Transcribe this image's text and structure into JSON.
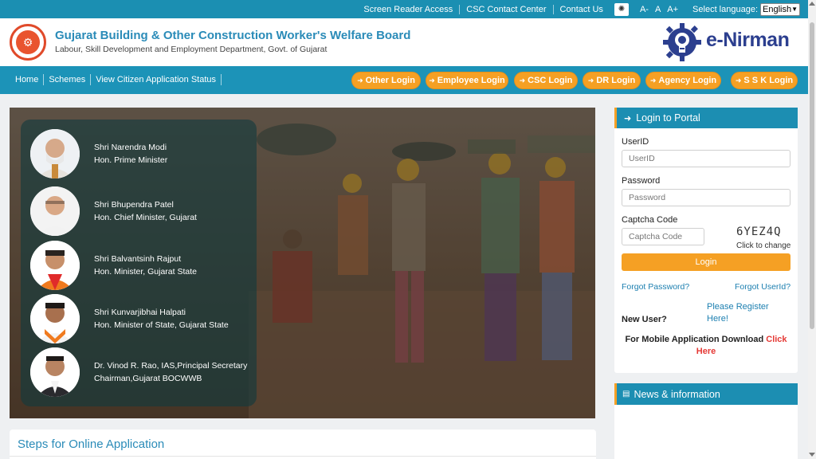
{
  "topbar": {
    "links": [
      "Screen Reader Access",
      "CSC Contact Center",
      "Contact Us"
    ],
    "font_sizes": [
      "A-",
      "A",
      "A+"
    ],
    "language_label": "Select language:",
    "language_value": "English"
  },
  "header": {
    "title": "Gujarat Building & Other Construction Worker's Welfare Board",
    "subtitle": "Labour, Skill Development and Employment Department, Govt. of Gujarat",
    "brand": "e-Nirman"
  },
  "nav": {
    "links": [
      "Home",
      "Schemes",
      "View Citizen Application Status"
    ],
    "login_buttons": [
      "Other Login",
      "Employee Login",
      "CSC Login",
      "DR Login",
      "Agency Login",
      "S S K Login"
    ]
  },
  "leaders": [
    {
      "name": "Shri Narendra Modi",
      "role": "Hon. Prime Minister"
    },
    {
      "name": "Shri Bhupendra Patel",
      "role": "Hon. Chief Minister, Gujarat"
    },
    {
      "name": "Shri Balvantsinh Rajput",
      "role": "Hon. Minister, Gujarat State"
    },
    {
      "name": "Shri Kunvarjibhai Halpati",
      "role": "Hon. Minister of State, Gujarat State"
    },
    {
      "name": "Dr. Vinod R. Rao, IAS,Principal Secretary",
      "role": "Chairman,Gujarat BOCWWB"
    }
  ],
  "steps": {
    "title": "Steps for Online Application"
  },
  "login": {
    "title": "Login to Portal",
    "userid_label": "UserID",
    "userid_placeholder": "UserID",
    "password_label": "Password",
    "password_placeholder": "Password",
    "captcha_label": "Captcha Code",
    "captcha_placeholder": "Captcha Code",
    "captcha_text": "6YEZ4Q",
    "captcha_change": "Click to change",
    "submit": "Login",
    "forgot_password": "Forgot Password?",
    "forgot_userid": "Forgot UserId?",
    "new_user": "New User?",
    "register_line1": "Please Register",
    "register_line2": "Here!",
    "mobile_text": "For Mobile Application Download",
    "mobile_link1": "Click",
    "mobile_link2": "Here"
  },
  "news": {
    "title": "News & information"
  },
  "colors": {
    "primary": "#1c93b8",
    "accent": "#f5a024",
    "brand_dark": "#2c3f8f",
    "link_red": "#e53935"
  }
}
